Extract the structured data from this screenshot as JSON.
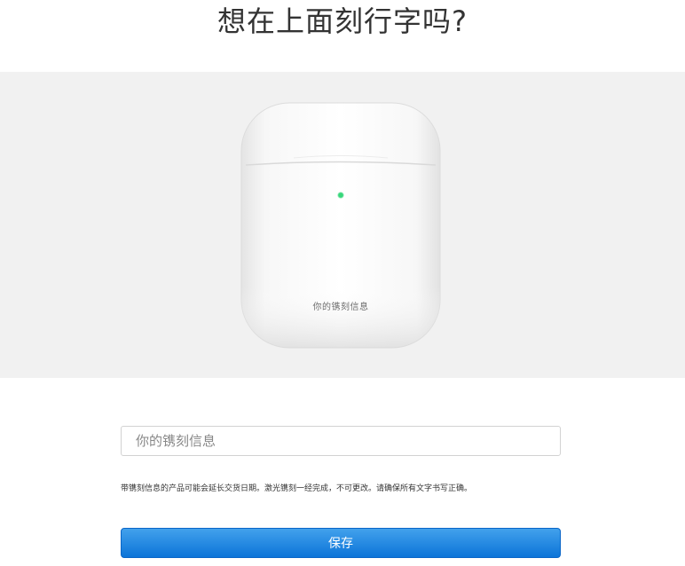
{
  "header": {
    "title": "想在上面刻行字吗?"
  },
  "preview": {
    "engraving_text": "你的镌刻信息",
    "indicator_color": "#37d67a",
    "background_color": "#f1f1f1"
  },
  "form": {
    "input_placeholder": "你的镌刻信息",
    "input_value": "",
    "notice": "带镌刻信息的产品可能会延长交货日期。激光镌刻一经完成，不可更改。请确保所有文字书写正确。",
    "save_label": "保存"
  }
}
